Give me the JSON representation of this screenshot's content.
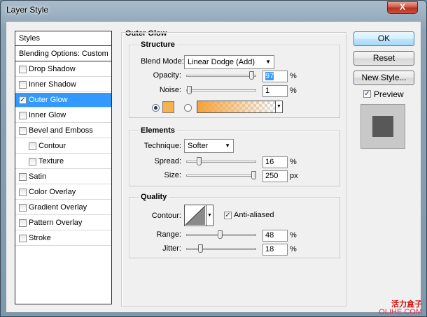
{
  "window": {
    "title": "Layer Style",
    "close_glyph": "X"
  },
  "styles_list": {
    "header": "Styles",
    "blending": "Blending Options: Custom",
    "items": [
      {
        "label": "Drop Shadow",
        "checked": false,
        "selected": false,
        "indent": false
      },
      {
        "label": "Inner Shadow",
        "checked": false,
        "selected": false,
        "indent": false
      },
      {
        "label": "Outer Glow",
        "checked": true,
        "selected": true,
        "indent": false
      },
      {
        "label": "Inner Glow",
        "checked": false,
        "selected": false,
        "indent": false
      },
      {
        "label": "Bevel and Emboss",
        "checked": false,
        "selected": false,
        "indent": false
      },
      {
        "label": "Contour",
        "checked": false,
        "selected": false,
        "indent": true
      },
      {
        "label": "Texture",
        "checked": false,
        "selected": false,
        "indent": true
      },
      {
        "label": "Satin",
        "checked": false,
        "selected": false,
        "indent": false
      },
      {
        "label": "Color Overlay",
        "checked": false,
        "selected": false,
        "indent": false
      },
      {
        "label": "Gradient Overlay",
        "checked": false,
        "selected": false,
        "indent": false
      },
      {
        "label": "Pattern Overlay",
        "checked": false,
        "selected": false,
        "indent": false
      },
      {
        "label": "Stroke",
        "checked": false,
        "selected": false,
        "indent": false
      }
    ]
  },
  "panel_title": "Outer Glow",
  "structure": {
    "title": "Structure",
    "blend_mode_label": "Blend Mode:",
    "blend_mode_value": "Linear Dodge (Add)",
    "opacity_label": "Opacity:",
    "opacity_value": "97",
    "opacity_unit": "%",
    "opacity_fraction": 0.97,
    "noise_label": "Noise:",
    "noise_value": "1",
    "noise_unit": "%",
    "noise_fraction": 0.01,
    "glow_color": "#f6b24e",
    "gradient_from": "#f6a23a"
  },
  "elements": {
    "title": "Elements",
    "technique_label": "Technique:",
    "technique_value": "Softer",
    "spread_label": "Spread:",
    "spread_value": "16",
    "spread_unit": "%",
    "spread_fraction": 0.16,
    "size_label": "Size:",
    "size_value": "250",
    "size_unit": "px",
    "size_fraction": 1.0
  },
  "quality": {
    "title": "Quality",
    "contour_label": "Contour:",
    "antialiased_label": "Anti-aliased",
    "antialiased_checked": true,
    "range_label": "Range:",
    "range_value": "48",
    "range_unit": "%",
    "range_fraction": 0.48,
    "jitter_label": "Jitter:",
    "jitter_value": "18",
    "jitter_unit": "%",
    "jitter_fraction": 0.18
  },
  "buttons": {
    "ok": "OK",
    "reset": "Reset",
    "new_style": "New Style..."
  },
  "preview": {
    "label": "Preview",
    "checked": true
  },
  "watermark": {
    "cn": "活力盒子",
    "en": "OLIHE.COM"
  }
}
